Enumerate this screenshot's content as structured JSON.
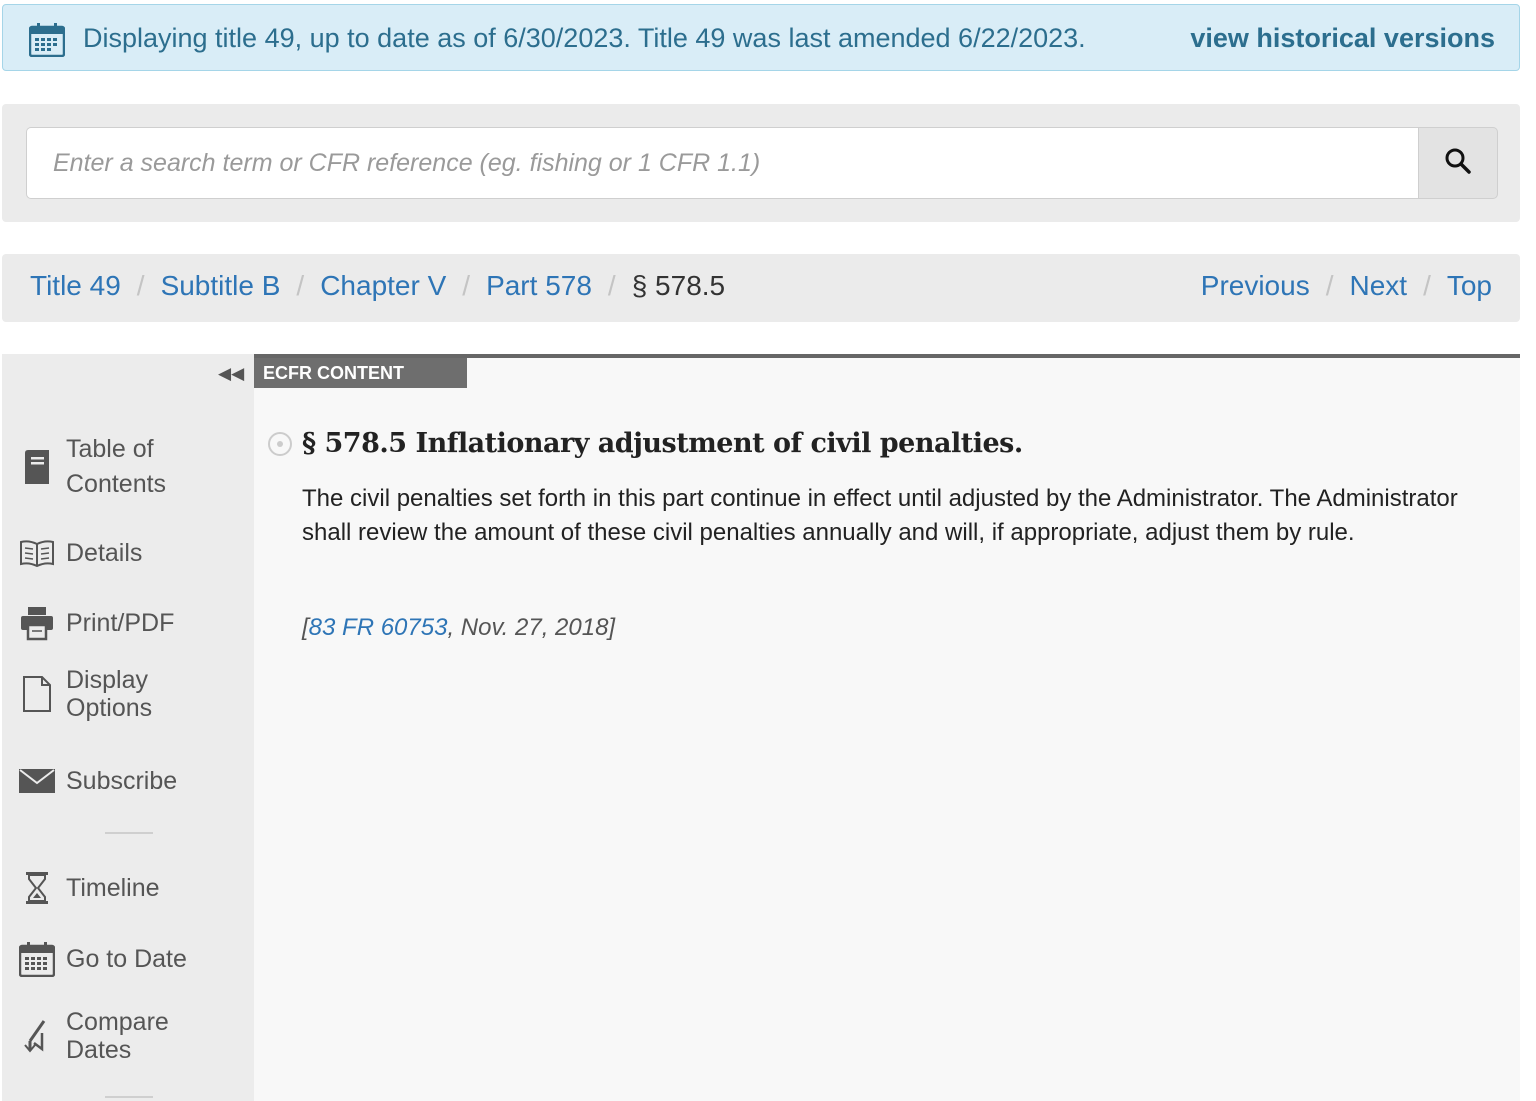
{
  "banner": {
    "message": "Displaying title 49, up to date as of 6/30/2023. Title 49 was last amended 6/22/2023.",
    "historical_link": "view historical versions"
  },
  "search": {
    "placeholder": "Enter a search term or CFR reference (eg. fishing or 1 CFR 1.1)"
  },
  "breadcrumb": {
    "items": [
      "Title 49",
      "Subtitle B",
      "Chapter V",
      "Part 578"
    ],
    "current": "§ 578.5",
    "separator": "/",
    "nav": [
      "Previous",
      "Next",
      "Top"
    ]
  },
  "sidebar": {
    "collapse_glyph": "◀◀",
    "items": [
      {
        "label_line1": "Table of",
        "label_line2": "Contents",
        "icon": "book-icon"
      },
      {
        "label": "Details",
        "icon": "open-book-icon"
      },
      {
        "label": "Print/PDF",
        "icon": "printer-icon"
      },
      {
        "label_line1": "Display",
        "label_line2": "Options",
        "icon": "document-icon"
      },
      {
        "label": "Subscribe",
        "icon": "envelope-icon"
      },
      {
        "label": "Timeline",
        "icon": "hourglass-icon"
      },
      {
        "label": "Go to Date",
        "icon": "calendar-icon"
      },
      {
        "label_line1": "Compare",
        "label_line2": "Dates",
        "icon": "compare-icon"
      }
    ]
  },
  "content": {
    "tab_label": "ECFR CONTENT",
    "section_title": "§ 578.5 Inflationary adjustment of civil penalties.",
    "body": "The civil penalties set forth in this part continue in effect until adjusted by the Administrator. The Administrator shall review the amount of these civil penalties annually and will, if appropriate, adjust them by rule.",
    "citation_open": "[",
    "citation_link": "83 FR 60753",
    "citation_rest": ", Nov. 27, 2018]"
  },
  "colors": {
    "link": "#2e75b6",
    "banner_bg": "#d9edf7",
    "banner_text": "#2c6e8e"
  }
}
